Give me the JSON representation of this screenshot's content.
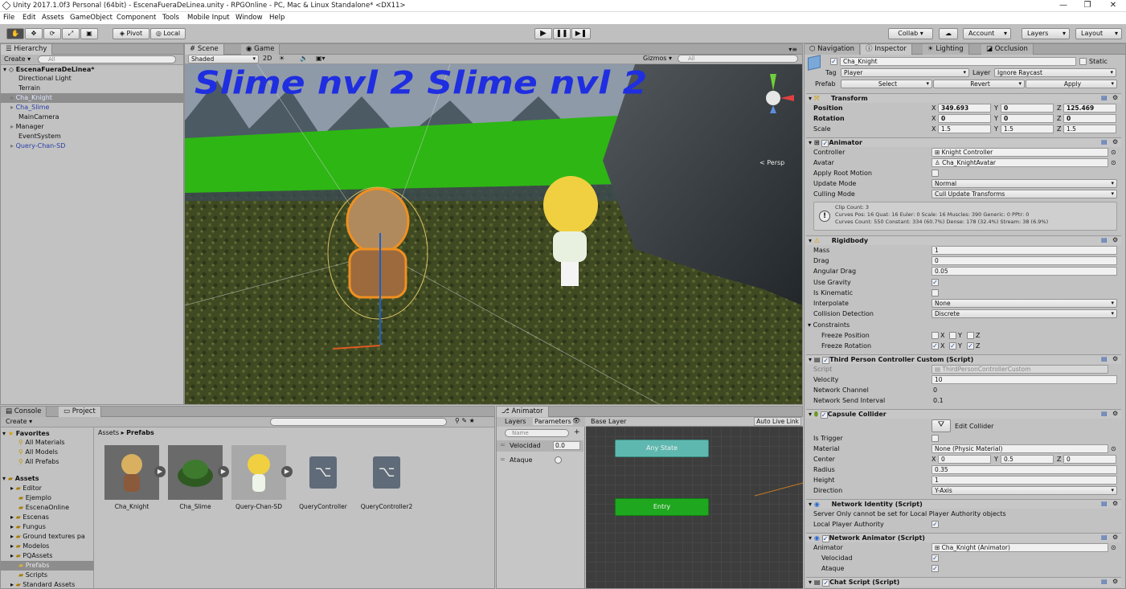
{
  "window": {
    "title": "Unity 2017.1.0f3 Personal (64bit) - EscenaFueraDeLinea.unity - RPGOnline - PC, Mac & Linux Standalone* <DX11>",
    "controls": [
      "—",
      "❐",
      "✕"
    ]
  },
  "menu": [
    "File",
    "Edit",
    "Assets",
    "GameObject",
    "Component",
    "Tools",
    "Mobile Input",
    "Window",
    "Help"
  ],
  "toolbar": {
    "pivot": "Pivot",
    "local": "Local",
    "collab": "Collab ▾",
    "account": "Account",
    "layers": "Layers",
    "layout": "Layout"
  },
  "hierarchy": {
    "tab": "Hierarchy",
    "create": "Create ▾",
    "search_placeholder": "All",
    "scene": "EscenaFueraDeLinea*",
    "items": [
      "Directional Light",
      "Terrain",
      "Cha_Knight",
      "Cha_Slime",
      "MainCamera",
      "Manager",
      "EventSystem",
      "Query-Chan-SD"
    ]
  },
  "scene_view": {
    "tabs": [
      "Scene",
      "Game"
    ],
    "shading": "Shaded",
    "mode_2d": "2D",
    "gizmos": "Gizmos ▾",
    "search_placeholder": "All",
    "persp": "< Persp",
    "banner": "Slime nvl 2 Slime nvl 2"
  },
  "console_project": {
    "tabs": [
      "Console",
      "Project"
    ],
    "create": "Create ▾",
    "favorites_label": "Favorites",
    "favorites": [
      "All Materials",
      "All Models",
      "All Prefabs"
    ],
    "assets_label": "Assets",
    "folders": [
      "Editor",
      "Ejemplo",
      "EscenaOnline",
      "Escenas",
      "Fungus",
      "Ground textures pa",
      "Modelos",
      "PQAssets",
      "Prefabs",
      "Scripts",
      "Standard Assets"
    ],
    "breadcrumb": [
      "Assets",
      "Prefabs"
    ],
    "assets": [
      "Cha_Knight",
      "Cha_Slime",
      "Query-Chan-SD",
      "QueryController",
      "QueryController2"
    ]
  },
  "animator": {
    "tab": "Animator",
    "subtabs": [
      "Layers",
      "Parameters"
    ],
    "search_placeholder": "Name",
    "parameters": [
      {
        "name": "Velocidad",
        "value": "0.0"
      },
      {
        "name": "Ataque",
        "value": ""
      }
    ],
    "base_layer": "Base Layer",
    "auto_live": "Auto Live Link",
    "states": [
      "Any State",
      "Entry"
    ]
  },
  "inspector": {
    "tabs": [
      "Navigation",
      "Inspector",
      "Lighting",
      "Occlusion"
    ],
    "object_name": "Cha_Knight",
    "static": "Static",
    "tag_label": "Tag",
    "tag": "Player",
    "layer_label": "Layer",
    "layer": "Ignore Raycast",
    "prefab_label": "Prefab",
    "prefab_buttons": [
      "Select",
      "Revert",
      "Apply"
    ],
    "transform": {
      "title": "Transform",
      "position_label": "Position",
      "position": [
        "349.693",
        "0",
        "125.469"
      ],
      "rotation_label": "Rotation",
      "rotation": [
        "0",
        "0",
        "0"
      ],
      "scale_label": "Scale",
      "scale": [
        "1.5",
        "1.5",
        "1.5"
      ]
    },
    "animator": {
      "title": "Animator",
      "controller_label": "Controller",
      "controller": "Knight Controller",
      "avatar_label": "Avatar",
      "avatar": "Cha_KnightAvatar",
      "root_motion_label": "Apply Root Motion",
      "update_label": "Update Mode",
      "update": "Normal",
      "culling_label": "Culling Mode",
      "culling": "Cull Update Transforms",
      "info": [
        "Clip Count: 3",
        "Curves Pos: 16 Quat: 16 Euler: 0 Scale: 16 Muscles: 390 Generic: 0 PPtr: 0",
        "Curves Count: 550 Constant: 334 (60.7%) Dense: 178 (32.4%) Stream: 38 (6.9%)"
      ]
    },
    "rigidbody": {
      "title": "Rigidbody",
      "mass_label": "Mass",
      "mass": "1",
      "drag_label": "Drag",
      "drag": "0",
      "angular_label": "Angular Drag",
      "angular": "0.05",
      "gravity_label": "Use Gravity",
      "kinematic_label": "Is Kinematic",
      "interpolate_label": "Interpolate",
      "interpolate": "None",
      "collision_label": "Collision Detection",
      "collision": "Discrete",
      "constraints_label": "Constraints",
      "freeze_pos_label": "Freeze Position",
      "freeze_rot_label": "Freeze Rotation"
    },
    "tpc": {
      "title": "Third Person Controller Custom (Script)",
      "script_label": "Script",
      "script": "ThirdPersonControllerCustom",
      "velocity_label": "Velocity",
      "velocity": "10",
      "channel_label": "Network Channel",
      "channel": "0",
      "interval_label": "Network Send Interval",
      "interval": "0.1"
    },
    "capsule": {
      "title": "Capsule Collider",
      "edit": "Edit Collider",
      "trigger_label": "Is Trigger",
      "material_label": "Material",
      "material": "None (Physic Material)",
      "center_label": "Center",
      "center": [
        "0",
        "0.5",
        "0"
      ],
      "radius_label": "Radius",
      "radius": "0.35",
      "height_label": "Height",
      "height": "1",
      "direction_label": "Direction",
      "direction": "Y-Axis"
    },
    "netid": {
      "title": "Network Identity (Script)",
      "note": "Server Only cannot be set for Local Player Authority objects",
      "lpa_label": "Local Player Authority"
    },
    "netanim": {
      "title": "Network Animator (Script)",
      "animator_label": "Animator",
      "animator": "Cha_Knight (Animator)",
      "vel_label": "Velocidad",
      "atk_label": "Ataque"
    },
    "chat": {
      "title": "Chat Script (Script)"
    }
  }
}
